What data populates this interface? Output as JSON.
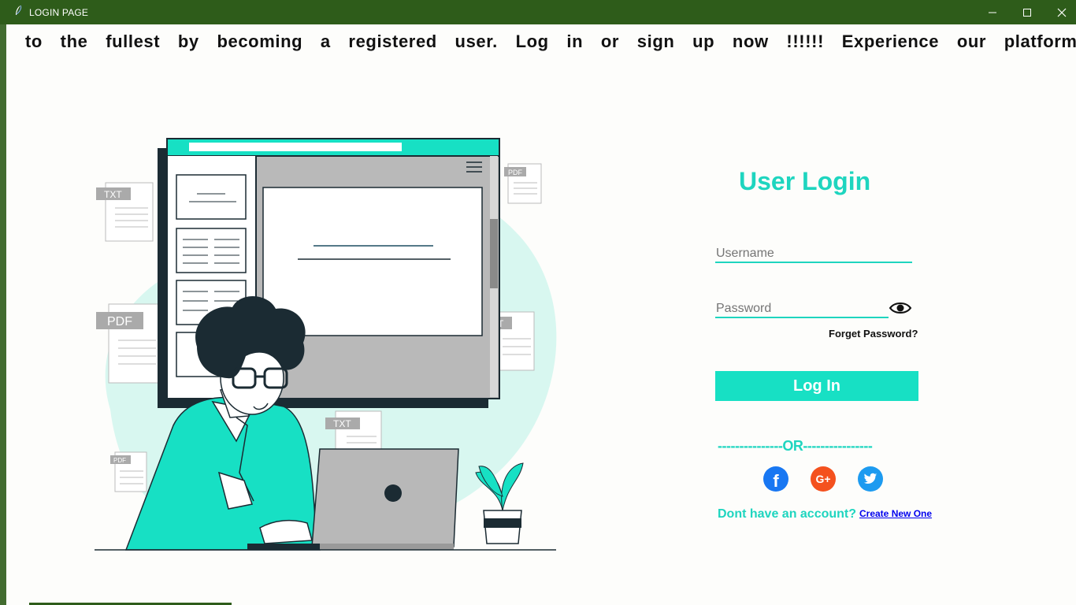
{
  "window": {
    "title": "LOGIN PAGE",
    "controls": {
      "minimize": "—",
      "maximize": "☐",
      "close": "✕"
    }
  },
  "marquee": {
    "text": "to the fullest by becoming a registered user. Log in or sign up now !!!!!! Experience our platform"
  },
  "illustration": {
    "file_labels": [
      "TXT",
      "PDF",
      "PDF",
      "TXT",
      "PDF",
      "T"
    ]
  },
  "login": {
    "title": "User Login",
    "username_placeholder": "Username",
    "password_placeholder": "Password",
    "forget_password": "Forget Password?",
    "login_button": "Log In",
    "or_divider": "---------------OR----------------",
    "no_account_text": "Dont have an account?",
    "create_link": "Create New One"
  },
  "social": {
    "facebook": {
      "icon": "facebook-icon",
      "color": "#1877f2",
      "glyph": "f"
    },
    "google": {
      "icon": "google-plus-icon",
      "color": "#f4511e",
      "glyph": "G+"
    },
    "twitter": {
      "icon": "twitter-icon",
      "color": "#1d9bf0"
    }
  },
  "colors": {
    "accent": "#1ed5bf",
    "title_bar": "#2e5c1a",
    "button": "#17e0c4"
  }
}
